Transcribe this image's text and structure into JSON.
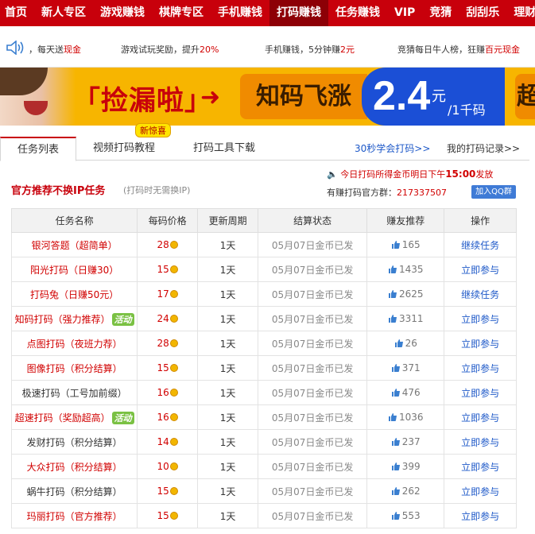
{
  "nav": [
    "首页",
    "新人专区",
    "游戏赚钱",
    "棋牌专区",
    "手机赚钱",
    "打码赚钱",
    "任务赚钱",
    "VIP",
    "竞猜",
    "刮刮乐",
    "理财"
  ],
  "nav_active_index": 5,
  "ticker": {
    "t1a": "，每天送",
    "t1b": "现金",
    "t2a": "游戏试玩奖励，提升",
    "t2b": "20%",
    "t3a": "手机赚钱，5分钟赚",
    "t3b": "2元",
    "t4a": "竞猜每日牛人榜，狂赚",
    "t4b": "百元现金"
  },
  "banner": {
    "slogan": "「捡漏啦」",
    "panel": "知码飞涨",
    "price": "2.4",
    "unit": "元",
    "per": "/1千码",
    "tail": "超"
  },
  "tabs": [
    "任务列表",
    "视频打码教程",
    "打码工具下载"
  ],
  "badge_new": "新惊喜",
  "links": {
    "learn": "30秒学会打码>>",
    "records": "我的打码记录>>"
  },
  "section": {
    "title": "官方推荐不换IP任务",
    "subtitle": "(打码时无需换IP)"
  },
  "notice": {
    "pre": "今日打码所得金币明日下午",
    "time": "15:00",
    "post": "发放"
  },
  "qq": {
    "label": "有赚打码官方群：",
    "number": "217337507",
    "button": "加入QQ群"
  },
  "table": {
    "headers": [
      "任务名称",
      "每码价格",
      "更新周期",
      "结算状态",
      "赚友推荐",
      "操作"
    ],
    "hot_label": "活动",
    "rows": [
      {
        "name": "银河答题（超简单）",
        "red": true,
        "hot": false,
        "price": "28",
        "cycle": "1天",
        "status": "05月07日金币已发",
        "likes": "165",
        "action": "继续任务"
      },
      {
        "name": "阳光打码（日赚30）",
        "red": true,
        "hot": false,
        "price": "15",
        "cycle": "1天",
        "status": "05月07日金币已发",
        "likes": "1435",
        "action": "立即参与"
      },
      {
        "name": "打码兔（日赚50元）",
        "red": true,
        "hot": false,
        "price": "17",
        "cycle": "1天",
        "status": "05月07日金币已发",
        "likes": "2625",
        "action": "继续任务"
      },
      {
        "name": "知码打码（强力推荐）",
        "red": true,
        "hot": true,
        "price": "24",
        "cycle": "1天",
        "status": "05月07日金币已发",
        "likes": "3311",
        "action": "立即参与"
      },
      {
        "name": "点图打码（夜班力荐）",
        "red": true,
        "hot": false,
        "price": "28",
        "cycle": "1天",
        "status": "05月07日金币已发",
        "likes": "26",
        "action": "立即参与"
      },
      {
        "name": "图像打码（积分结算）",
        "red": true,
        "hot": false,
        "price": "15",
        "cycle": "1天",
        "status": "05月07日金币已发",
        "likes": "371",
        "action": "立即参与"
      },
      {
        "name": "极速打码（工号加前缀）",
        "red": false,
        "hot": false,
        "price": "16",
        "cycle": "1天",
        "status": "05月07日金币已发",
        "likes": "476",
        "action": "立即参与"
      },
      {
        "name": "超速打码（奖励超高）",
        "red": true,
        "hot": true,
        "price": "16",
        "cycle": "1天",
        "status": "05月07日金币已发",
        "likes": "1036",
        "action": "立即参与"
      },
      {
        "name": "发财打码（积分结算）",
        "red": false,
        "hot": false,
        "price": "14",
        "cycle": "1天",
        "status": "05月07日金币已发",
        "likes": "237",
        "action": "立即参与"
      },
      {
        "name": "大众打码（积分结算）",
        "red": true,
        "hot": false,
        "price": "10",
        "cycle": "1天",
        "status": "05月07日金币已发",
        "likes": "399",
        "action": "立即参与"
      },
      {
        "name": "蜗牛打码（积分结算）",
        "red": false,
        "hot": false,
        "price": "15",
        "cycle": "1天",
        "status": "05月07日金币已发",
        "likes": "262",
        "action": "立即参与"
      },
      {
        "name": "玛丽打码（官方推荐）",
        "red": true,
        "hot": false,
        "price": "15",
        "cycle": "1天",
        "status": "05月07日金币已发",
        "likes": "553",
        "action": "立即参与"
      }
    ]
  }
}
